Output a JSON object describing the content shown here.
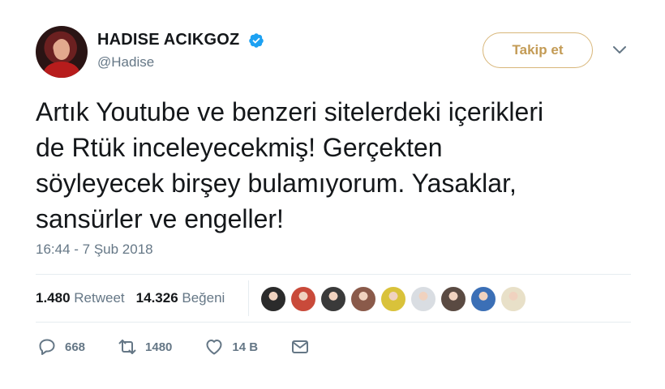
{
  "author": {
    "display_name": "HADISE ACIKGOZ",
    "handle": "@Hadise",
    "verified": true,
    "avatar_icon": "profile-photo"
  },
  "follow_button": {
    "label": "Takip et",
    "color": "#c39b55"
  },
  "tweet": {
    "text": "Artık Youtube ve benzeri sitelerdeki içerikleri\nde Rtük inceleyecekmiş! Gerçekten\nsöyleyecek birşey bulamıyorum. Yasaklar,\nsansürler ve engeller!",
    "timestamp": "16:44 - 7 Şub 2018"
  },
  "stats": {
    "retweets": {
      "count": "1.480",
      "label": "Retweet"
    },
    "likes": {
      "count": "14.326",
      "label": "Beğeni"
    }
  },
  "likers": [
    {
      "icon": "liker-avatar-1",
      "color": "#2b2b2b"
    },
    {
      "icon": "liker-avatar-2",
      "color": "#c94a3a"
    },
    {
      "icon": "liker-avatar-3",
      "color": "#3a3a3a"
    },
    {
      "icon": "liker-avatar-4",
      "color": "#8a5a4a"
    },
    {
      "icon": "liker-avatar-5",
      "color": "#d9c23a"
    },
    {
      "icon": "liker-avatar-6",
      "color": "#d9dde2"
    },
    {
      "icon": "liker-avatar-7",
      "color": "#5a4a42"
    },
    {
      "icon": "liker-avatar-8",
      "color": "#3b6fb6"
    },
    {
      "icon": "liker-avatar-9",
      "color": "#e8e0c8"
    }
  ],
  "actions": {
    "reply": {
      "icon": "reply-icon",
      "count": "668"
    },
    "retweet": {
      "icon": "retweet-icon",
      "count": "1480"
    },
    "like": {
      "icon": "heart-icon",
      "count": "14 B"
    },
    "message": {
      "icon": "envelope-icon"
    }
  },
  "colors": {
    "verified": "#1da1f2",
    "secondary_text": "#657786",
    "primary_text": "#14171a"
  }
}
